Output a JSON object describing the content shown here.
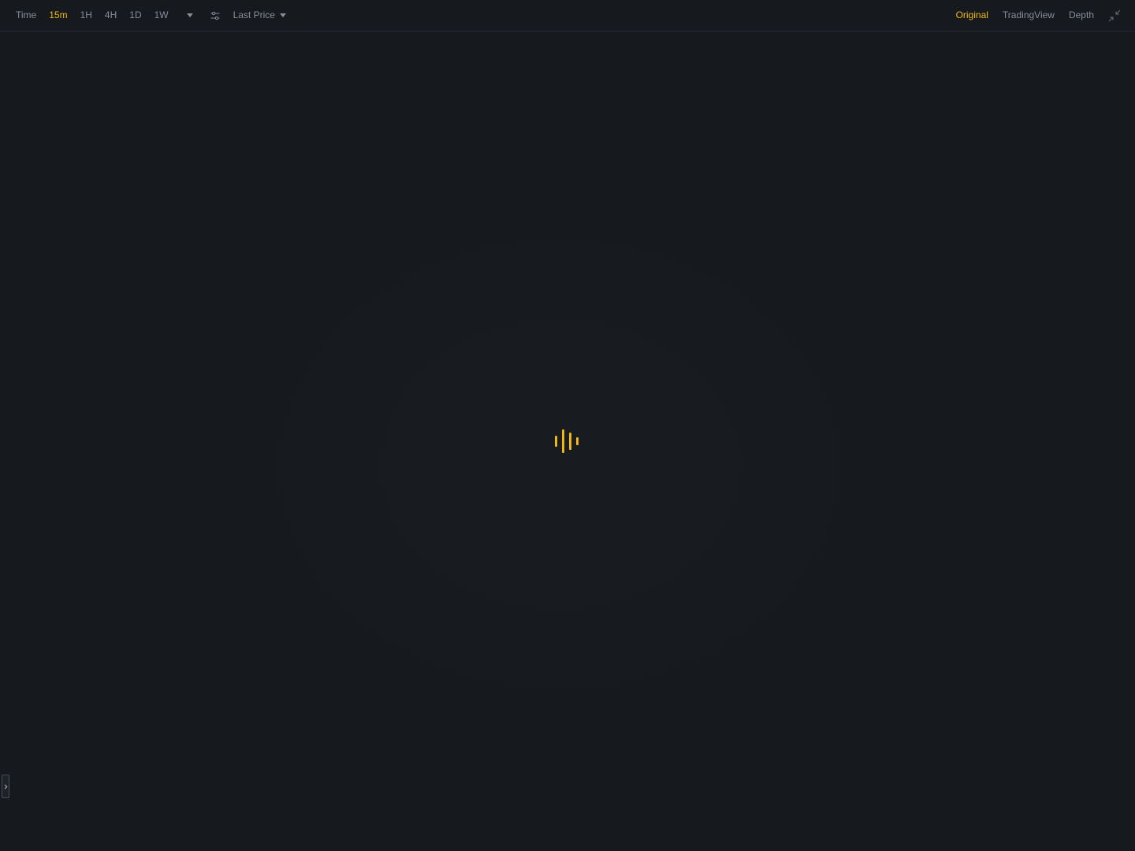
{
  "toolbar": {
    "intervals": [
      {
        "label": "Time",
        "active": false
      },
      {
        "label": "15m",
        "active": true
      },
      {
        "label": "1H",
        "active": false
      },
      {
        "label": "4H",
        "active": false
      },
      {
        "label": "1D",
        "active": false
      },
      {
        "label": "1W",
        "active": false
      }
    ],
    "more_intervals_icon": "chevron-down-icon",
    "settings_icon": "sliders-icon",
    "price_type": {
      "label": "Last Price",
      "icon": "caret-down-icon"
    },
    "views": [
      {
        "label": "Original",
        "active": true
      },
      {
        "label": "TradingView",
        "active": false
      },
      {
        "label": "Depth",
        "active": false
      }
    ],
    "fullscreen_icon": "collapse-icon"
  },
  "chart": {
    "state": "loading",
    "loader_icon": "loading-bars-icon"
  },
  "sidebar_toggle": {
    "icon": "chevron-right-icon"
  },
  "colors": {
    "background": "#161a1e",
    "accent": "#f0b90b",
    "text_muted": "#848e9c",
    "divider": "#252930"
  }
}
